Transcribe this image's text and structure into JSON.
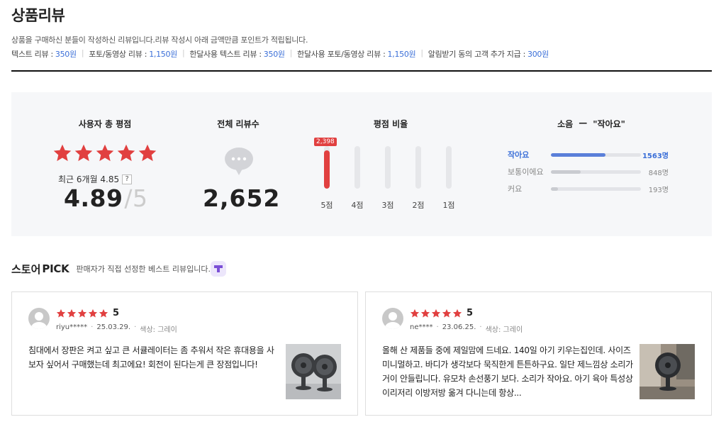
{
  "header": {
    "title": "상품리뷰",
    "description": "상품을 구매하신 분들이 작성하신 리뷰입니다.리뷰 작성시 아래 금액만큼 포인트가 적립됩니다.",
    "points": [
      {
        "label": "텍스트 리뷰 :",
        "amount": "350원"
      },
      {
        "label": "포토/동영상 리뷰 :",
        "amount": "1,150원"
      },
      {
        "label": "한달사용 텍스트 리뷰 :",
        "amount": "350원"
      },
      {
        "label": "한달사용 포토/동영상 리뷰 :",
        "amount": "1,150원"
      },
      {
        "label": "알림받기 동의 고객 추가 지급 :",
        "amount": "300원"
      }
    ]
  },
  "summary": {
    "rating": {
      "title": "사용자 총 평점",
      "stars": 5,
      "recent_label": "최근 6개월 4.85",
      "help_label": "?",
      "value": "4.89",
      "slash": "/",
      "max": "5"
    },
    "total": {
      "title": "전체 리뷰수",
      "value": "2,652"
    },
    "ratio": {
      "title": "평점 비율",
      "bars": [
        {
          "label": "5점",
          "fraction": 0.9,
          "badge": "2,398"
        },
        {
          "label": "4점",
          "fraction": 0.0
        },
        {
          "label": "3점",
          "fraction": 0.0
        },
        {
          "label": "2점",
          "fraction": 0.0
        },
        {
          "label": "1점",
          "fraction": 0.0
        }
      ]
    },
    "noise": {
      "title_prefix": "소음",
      "title_dash": "—",
      "title_value": "\"작아요\"",
      "rows": [
        {
          "label": "작아요",
          "fraction": 0.61,
          "count": "1563명",
          "active": true
        },
        {
          "label": "보통이에요",
          "fraction": 0.33,
          "count": "848명",
          "active": false
        },
        {
          "label": "커요",
          "fraction": 0.08,
          "count": "193명",
          "active": false
        }
      ]
    }
  },
  "store_pick": {
    "title_a": "스토어",
    "title_b": "PICK",
    "subtitle": "판매자가 직접 선정한 베스트 리뷰입니다.",
    "reviews": [
      {
        "score": "5",
        "user": "riyu*****",
        "date": "25.03.29.",
        "option": "색상: 그레이",
        "text": "침대에서 장판은 켜고 싶고 큰 서큘레이터는 좀 추워서 작은 휴대용을 사보자 싶어서 구매했는데 최고에요! 회전이 된다는게 큰 장점입니다!"
      },
      {
        "score": "5",
        "user": "ne****",
        "date": "23.06.25.",
        "option": "색상: 그레이",
        "text": "올해 산 제품들 중에 제일맘에 드네요. 140일 아기 키우는집인데. 사이즈 미니멀하고. 바디가 생각보다 묵직한게 튼튼하구요. 일단 제느낌상 소리가 거이 안들립니다. 유모차 손선풍기 보다. 소리가 작아요. 아기 육아 특성상 이리저리 이방저방 옮겨 다니는데 항상..."
      }
    ]
  },
  "colors": {
    "star": "#e14040",
    "accent": "#3b6fd8"
  }
}
